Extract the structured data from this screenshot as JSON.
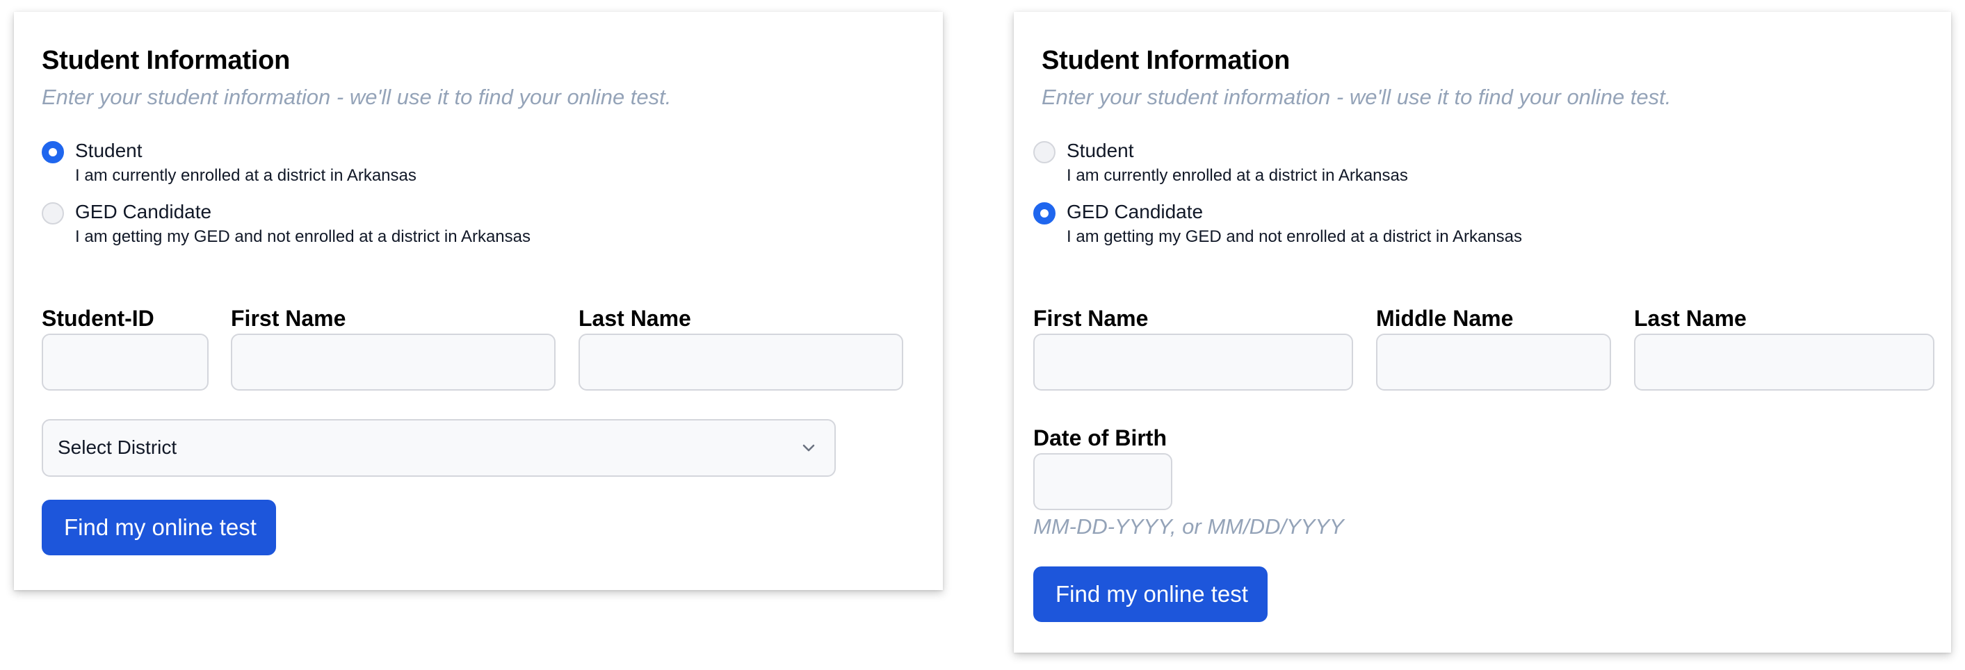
{
  "forms": {
    "student": {
      "title": "Student Information",
      "subtitle": "Enter your student information - we'll use it to find your online test.",
      "options": [
        {
          "label": "Student",
          "description": "I am currently enrolled at a district in Arkansas",
          "selected": true
        },
        {
          "label": "GED Candidate",
          "description": "I am getting my GED and not enrolled at a district in Arkansas",
          "selected": false
        }
      ],
      "fields": {
        "student_id": {
          "label": "Student-ID",
          "value": ""
        },
        "first_name": {
          "label": "First Name",
          "value": ""
        },
        "last_name": {
          "label": "Last Name",
          "value": ""
        }
      },
      "district_select": {
        "value": "Select District",
        "icon": "chevron-down-icon"
      },
      "submit_label": "Find my online test"
    },
    "ged": {
      "title": "Student Information",
      "subtitle": "Enter your student information - we'll use it to find your online test.",
      "options": [
        {
          "label": "Student",
          "description": "I am currently enrolled at a district in Arkansas",
          "selected": false
        },
        {
          "label": "GED Candidate",
          "description": "I am getting my GED and not enrolled at a district in Arkansas",
          "selected": true
        }
      ],
      "fields": {
        "first_name": {
          "label": "First Name",
          "value": ""
        },
        "middle_name": {
          "label": "Middle Name",
          "value": ""
        },
        "last_name": {
          "label": "Last Name",
          "value": ""
        },
        "date_of_birth": {
          "label": "Date of Birth",
          "value": "",
          "hint": "MM-DD-YYYY, or MM/DD/YYYY"
        }
      },
      "submit_label": "Find my online test"
    }
  },
  "colors": {
    "accent": "#1d56db",
    "radio_selected": "#1f66ee",
    "muted_text": "#94a3b8",
    "input_bg": "#f8f9fb",
    "input_border": "#d4d6dc"
  }
}
